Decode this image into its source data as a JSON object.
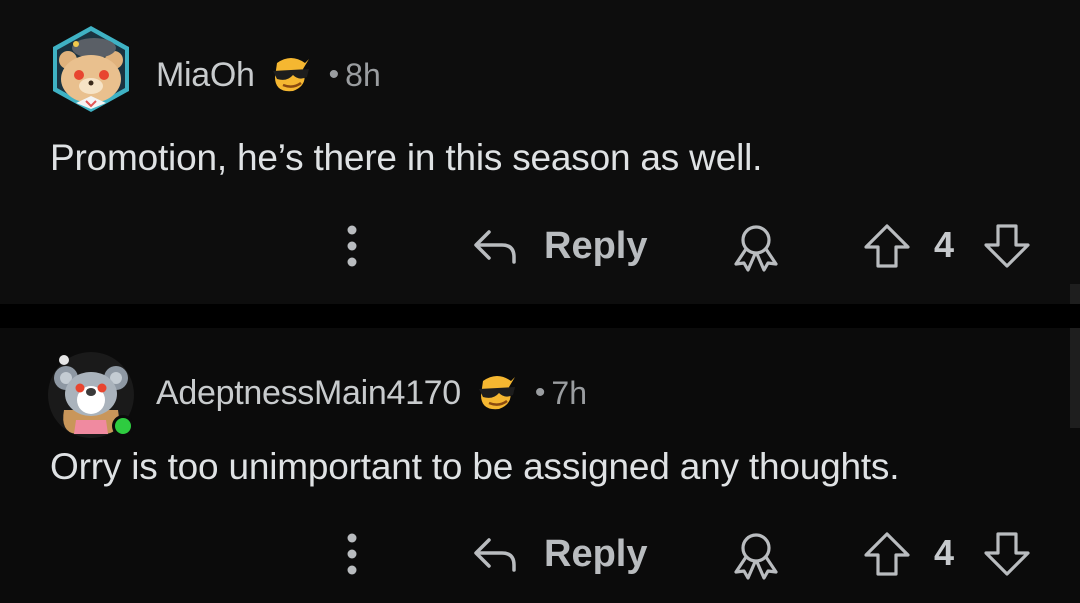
{
  "comments": [
    {
      "username": "MiaOh",
      "separator": "•",
      "time": "8h",
      "body": "Promotion, he’s there in this season as well.",
      "reply_label": "Reply",
      "votes": "4",
      "avatar_icon": "bear-avatar-icon",
      "flair_icon": "sunglasses-emoji-flair-icon"
    },
    {
      "username": "AdeptnessMain4170",
      "separator": "•",
      "time": "7h",
      "body": "Orry is too unimportant to be assigned any thoughts.",
      "reply_label": "Reply",
      "votes": "4",
      "avatar_icon": "koala-avatar-icon",
      "flair_icon": "sunglasses-emoji-flair-icon",
      "online": true
    }
  ],
  "colors": {
    "background": "#0b0b0b",
    "divider": "#000000",
    "text": "#dfe2e4",
    "meta": "#9a9da0",
    "online": "#2ecc40",
    "hexagon_border": "#3fb2c4"
  }
}
